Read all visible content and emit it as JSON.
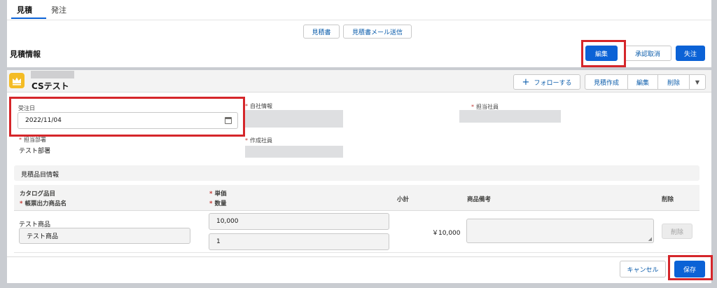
{
  "tabs": [
    {
      "label": "見積",
      "active": true
    },
    {
      "label": "発注",
      "active": false
    }
  ],
  "top_buttons": {
    "quote_doc": "見積書",
    "quote_email": "見積書メール送信"
  },
  "section_title": "見積情報",
  "header_actions": {
    "edit": "編集",
    "approve_cancel": "承認取消",
    "lost": "失注"
  },
  "record": {
    "name": "CSテスト",
    "actions": {
      "follow": "フォローする",
      "create_quote": "見積作成",
      "edit": "編集",
      "delete": "削除"
    }
  },
  "form": {
    "order_date_label": "受注日",
    "order_date_value": "2022/11/04",
    "company_info_label": "自社情報",
    "staff_label": "担当社員",
    "department_label": "担当部署",
    "department_value": "テスト部署",
    "creator_label": "作成社員"
  },
  "items_section": {
    "title": "見積品目情報",
    "headers": {
      "catalog": "カタログ品目",
      "print_name": "帳票出力商品名",
      "unit_price": "単価",
      "quantity": "数量",
      "subtotal": "小計",
      "remarks": "商品備考",
      "delete": "削除"
    },
    "rows": [
      {
        "catalog": "テスト商品",
        "print_name": "テスト商品",
        "unit_price": "10,000",
        "quantity": "1",
        "subtotal": "￥10,000",
        "delete": "削除"
      }
    ]
  },
  "footer": {
    "cancel": "キャンセル",
    "save": "保存"
  },
  "colors": {
    "brand": "#0b62d6",
    "highlight": "#d5262a",
    "crown_icon_bg": "#f4bc25"
  }
}
